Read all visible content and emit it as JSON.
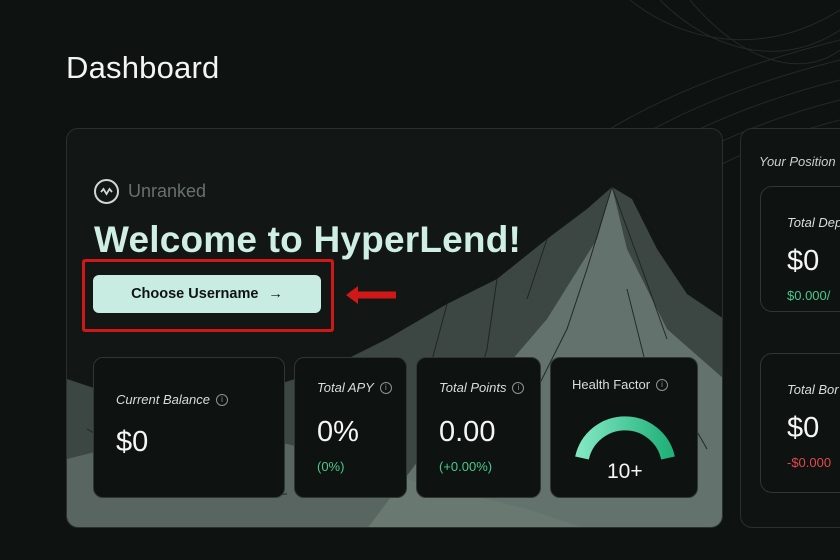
{
  "page": {
    "title": "Dashboard"
  },
  "hero": {
    "rank_label": "Unranked",
    "welcome": "Welcome to HyperLend!",
    "choose_username_label": "Choose Username",
    "choose_username_arrow": "→"
  },
  "stats": {
    "current_balance": {
      "title": "Current Balance",
      "value": "$0"
    },
    "total_apy": {
      "title": "Total APY",
      "value": "0%",
      "change": "(0%)"
    },
    "total_points": {
      "title": "Total Points",
      "value": "0.00",
      "change": "(+0.00%)"
    },
    "health_factor": {
      "title": "Health Factor",
      "value": "10+"
    }
  },
  "side": {
    "title": "Your Position",
    "deposit": {
      "label": "Total Dep",
      "value": "$0",
      "change": "$0.000/"
    },
    "borrow": {
      "label": "Total Bor",
      "value": "$0",
      "change": "-$0.000"
    }
  },
  "colors": {
    "accent": "#c8ece2",
    "positive": "#49c98a",
    "negative": "#e0494b",
    "annotation": "#d01818",
    "gauge_start": "#7fe6c1",
    "gauge_end": "#22b27a"
  },
  "icons": {
    "rank": "wave-circle-icon",
    "info": "info-icon",
    "annotation_arrow": "left-arrow-icon"
  }
}
